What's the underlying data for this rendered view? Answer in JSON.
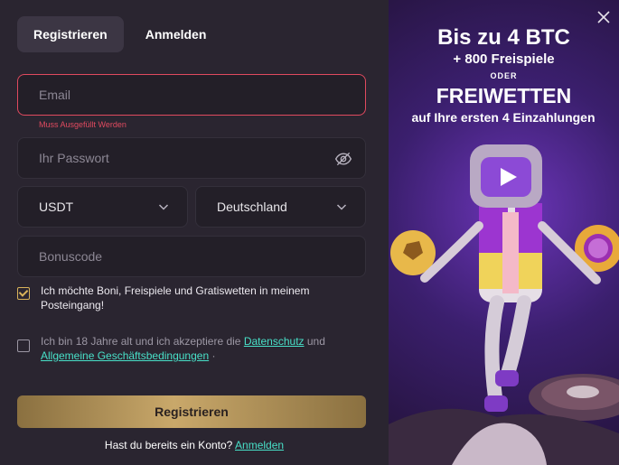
{
  "tabs": {
    "register": "Registrieren",
    "login": "Anmelden"
  },
  "form": {
    "email_placeholder": "Email",
    "email_error": "Muss Ausgefüllt Werden",
    "password_placeholder": "Ihr Passwort",
    "currency_value": "USDT",
    "country_value": "Deutschland",
    "bonus_placeholder": "Bonuscode",
    "newsletter_text": "Ich möchte Boni, Freispiele und Gratiswetten in meinem Posteingang!",
    "newsletter_checked": true,
    "terms_prefix": "Ich bin 18 Jahre alt und ich akzeptiere die",
    "terms_privacy_link": "Datenschutz",
    "terms_and": "und",
    "terms_tos_link": "Allgemeine Geschäftsbedingungen",
    "terms_suffix": "·",
    "terms_checked": false,
    "submit_label": "Registrieren",
    "footer_text": "Hast du bereits ein Konto?",
    "footer_link": "Anmelden"
  },
  "promo": {
    "line1": "Bis zu 4 BTC",
    "line2": "+ 800 Freispiele",
    "line3": "ODER",
    "line4": "FREIWETTEN",
    "line5": "auf Ihre ersten 4 Einzahlungen"
  },
  "colors": {
    "accent_gold": "#c9a86a",
    "error": "#e04a5f",
    "link": "#48e0c8",
    "panel_bg": "#2a2530"
  },
  "icons": {
    "password_toggle": "eye-off-icon",
    "select_chevron": "chevron-down-icon",
    "close": "close-icon"
  }
}
